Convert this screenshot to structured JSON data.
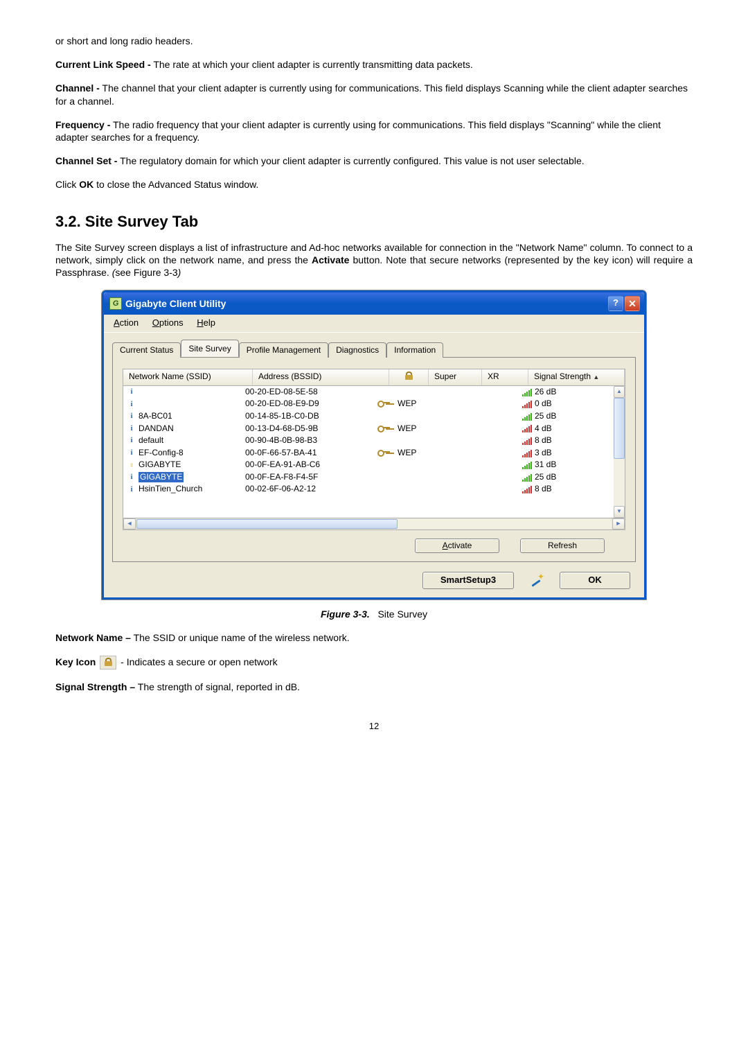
{
  "intro": {
    "p1": "or short and long radio headers.",
    "p2a": "Current Link Speed -",
    "p2b": " The rate at which your client adapter is currently transmitting data packets.",
    "p3a": "Channel -",
    "p3b": " The channel that your client adapter is currently using for communications. This field displays Scanning while the client adapter searches for a channel.",
    "p4a": "Frequency -",
    "p4b": " The radio frequency that your client adapter is currently using for communications. This field displays \"Scanning\" while the client adapter searches for a frequency.",
    "p5a": "Channel Set -",
    "p5b": " The regulatory domain for which your client adapter is currently configured. This value is not user selectable.",
    "p6a": "Click ",
    "p6b": "OK",
    "p6c": " to close the Advanced Status window."
  },
  "heading": "3.2.  Site Survey Tab",
  "sitepara_a": "The Site Survey screen displays a list of infrastructure and Ad-hoc networks available for connection in the \"Network Name\" column.   To connect to a network, simply click on the network name, and press the ",
  "sitepara_b": "Activate",
  "sitepara_c": " button. Note that secure networks (represented by the key icon) will require a Passphrase. ",
  "sitepara_d": "(",
  "sitepara_e": "see Figure 3-3",
  "sitepara_f": ")",
  "window": {
    "title": "Gigabyte Client Utility",
    "menu": {
      "action": "Action",
      "options": "Options",
      "help": "Help"
    },
    "tabs": {
      "current": "Current Status",
      "site": "Site Survey",
      "profile": "Profile Management",
      "diag": "Diagnostics",
      "info": "Information"
    },
    "headers": {
      "name": "Network Name (SSID)",
      "addr": "Address (BSSID)",
      "super": "Super",
      "xr": "XR",
      "sig": "Signal Strength"
    },
    "rows": [
      {
        "name": "",
        "addr": "00-20-ED-08-5E-58",
        "key": false,
        "enc": "",
        "sig": "26 dB",
        "red": false,
        "yellow": false
      },
      {
        "name": "",
        "addr": "00-20-ED-08-E9-D9",
        "key": true,
        "enc": "WEP",
        "sig": "0 dB",
        "red": true,
        "yellow": false
      },
      {
        "name": "8A-BC01",
        "addr": "00-14-85-1B-C0-DB",
        "key": false,
        "enc": "",
        "sig": "25 dB",
        "red": false,
        "yellow": false
      },
      {
        "name": "DANDAN",
        "addr": "00-13-D4-68-D5-9B",
        "key": true,
        "enc": "WEP",
        "sig": "4 dB",
        "red": true,
        "yellow": false
      },
      {
        "name": "default",
        "addr": "00-90-4B-0B-98-B3",
        "key": false,
        "enc": "",
        "sig": "8 dB",
        "red": true,
        "yellow": false
      },
      {
        "name": "EF-Config-8",
        "addr": "00-0F-66-57-BA-41",
        "key": true,
        "enc": "WEP",
        "sig": "3 dB",
        "red": true,
        "yellow": false
      },
      {
        "name": "GIGABYTE",
        "addr": "00-0F-EA-91-AB-C6",
        "key": false,
        "enc": "",
        "sig": "31 dB",
        "red": false,
        "yellow": true
      },
      {
        "name": "GIGABYTE",
        "addr": "00-0F-EA-F8-F4-5F",
        "key": false,
        "enc": "",
        "sig": "25 dB",
        "red": false,
        "yellow": false,
        "selected": true
      },
      {
        "name": "HsinTien_Church",
        "addr": "00-02-6F-06-A2-12",
        "key": false,
        "enc": "",
        "sig": "8 dB",
        "red": true,
        "yellow": false
      }
    ],
    "buttons": {
      "activate": "Activate",
      "refresh": "Refresh",
      "smartsetup": "SmartSetup3",
      "ok": "OK"
    }
  },
  "figure": {
    "label": "Figure 3-3.",
    "caption": "Site Survey"
  },
  "defs": {
    "nn_a": "Network Name –",
    "nn_b": " The SSID or unique name of the wireless network.",
    "ki_a": "Key Icon ",
    "ki_b": " - Indicates a secure or open network",
    "ss_a": "Signal Strength –",
    "ss_b": " The strength of signal, reported in dB."
  },
  "pagenum": "12"
}
